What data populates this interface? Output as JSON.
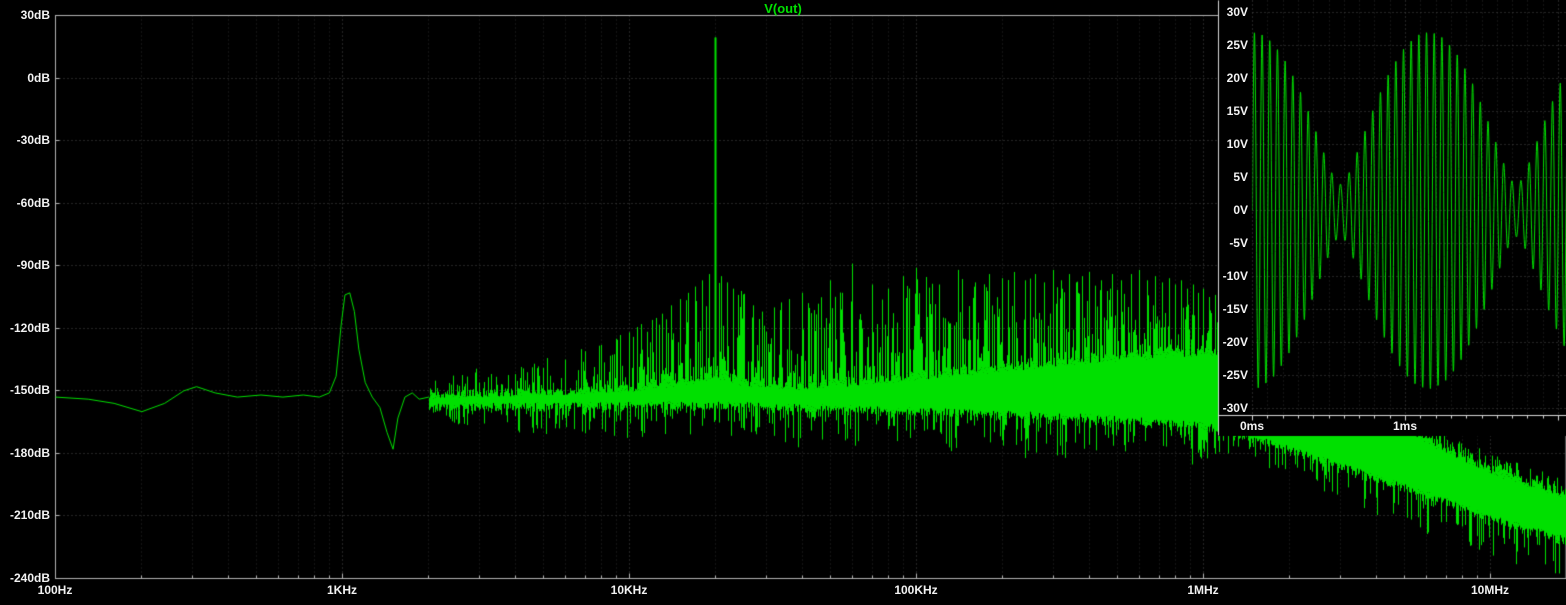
{
  "title": "V(out)",
  "colors": {
    "background": "#000000",
    "trace": "#00e000",
    "title": "#00e000",
    "grid_minor": "#2b2b2b",
    "grid_major": "#4a4a4a",
    "border": "#b4b4b4",
    "inset_border": "#d8d8d8",
    "text": "#f2f2f2"
  },
  "chart_data": [
    {
      "id": "fft-spectrum",
      "type": "line",
      "title": "V(out)",
      "x_axis": {
        "scale": "log",
        "unit": "Hz",
        "range_hz": [
          100,
          18500000
        ],
        "ticks": [
          {
            "label": "100Hz",
            "hz": 100
          },
          {
            "label": "1KHz",
            "hz": 1000
          },
          {
            "label": "10KHz",
            "hz": 10000
          },
          {
            "label": "100KHz",
            "hz": 100000
          },
          {
            "label": "1MHz",
            "hz": 1000000
          },
          {
            "label": "10MHz",
            "hz": 10000000
          }
        ]
      },
      "y_axis": {
        "unit": "dB",
        "range_db": [
          -240,
          30
        ],
        "step_db": 30,
        "ticks": [
          {
            "label": "30dB",
            "db": 30
          },
          {
            "label": "0dB",
            "db": 0
          },
          {
            "label": "-30dB",
            "db": -30
          },
          {
            "label": "-60dB",
            "db": -60
          },
          {
            "label": "-90dB",
            "db": -90
          },
          {
            "label": "-120dB",
            "db": -120
          },
          {
            "label": "-150dB",
            "db": -150
          },
          {
            "label": "-180dB",
            "db": -180
          },
          {
            "label": "-210dB",
            "db": -210
          },
          {
            "label": "-240dB",
            "db": -240
          }
        ]
      },
      "baseline_points_hz_db": [
        [
          100,
          -153
        ],
        [
          130,
          -154
        ],
        [
          160,
          -156
        ],
        [
          200,
          -160
        ],
        [
          240,
          -156
        ],
        [
          280,
          -150
        ],
        [
          310,
          -148
        ],
        [
          360,
          -151
        ],
        [
          430,
          -153
        ],
        [
          520,
          -152
        ],
        [
          620,
          -153
        ],
        [
          730,
          -152
        ],
        [
          830,
          -153
        ],
        [
          900,
          -151
        ],
        [
          950,
          -143
        ],
        [
          990,
          -118
        ],
        [
          1020,
          -104
        ],
        [
          1060,
          -103
        ],
        [
          1100,
          -112
        ],
        [
          1140,
          -130
        ],
        [
          1200,
          -146
        ],
        [
          1270,
          -153
        ],
        [
          1350,
          -158
        ],
        [
          1430,
          -170
        ],
        [
          1500,
          -178
        ],
        [
          1560,
          -163
        ],
        [
          1650,
          -153
        ],
        [
          1750,
          -151
        ],
        [
          1850,
          -154
        ],
        [
          2000,
          -153
        ]
      ],
      "peaks_hz_db": [
        [
          3000,
          -146
        ],
        [
          4000,
          -142
        ],
        [
          5000,
          -139
        ],
        [
          6000,
          -135
        ],
        [
          7000,
          -131
        ],
        [
          8000,
          -128
        ],
        [
          9000,
          -125
        ],
        [
          10000,
          -122
        ],
        [
          11000,
          -118
        ],
        [
          12000,
          -116
        ],
        [
          13000,
          -113
        ],
        [
          14000,
          -109
        ],
        [
          15000,
          -106
        ],
        [
          16000,
          -103
        ],
        [
          17000,
          -100
        ],
        [
          18000,
          -97
        ],
        [
          19000,
          -94
        ],
        [
          20000,
          19.5
        ],
        [
          21000,
          -95
        ],
        [
          22000,
          -98
        ],
        [
          23000,
          -101
        ],
        [
          24000,
          -104
        ],
        [
          25000,
          -106
        ],
        [
          27000,
          -109
        ],
        [
          29000,
          -112
        ],
        [
          32000,
          -110
        ],
        [
          36000,
          -106
        ],
        [
          40000,
          -103
        ],
        [
          50000,
          -97
        ],
        [
          60000,
          -89
        ],
        [
          70000,
          -99
        ],
        [
          80000,
          -101
        ],
        [
          90000,
          -95
        ],
        [
          100000,
          -91
        ],
        [
          120000,
          -99
        ],
        [
          140000,
          -92
        ],
        [
          160000,
          -98
        ],
        [
          180000,
          -94
        ],
        [
          200000,
          -96
        ],
        [
          220000,
          -93
        ],
        [
          240000,
          -97
        ],
        [
          260000,
          -94
        ],
        [
          280000,
          -98
        ],
        [
          300000,
          -92
        ],
        [
          320000,
          -97
        ],
        [
          340000,
          -94
        ],
        [
          360000,
          -98
        ],
        [
          380000,
          -95
        ],
        [
          400000,
          -93
        ],
        [
          440000,
          -97
        ],
        [
          480000,
          -94
        ],
        [
          520000,
          -97
        ],
        [
          560000,
          -94
        ],
        [
          600000,
          -92
        ],
        [
          640000,
          -97
        ],
        [
          680000,
          -95
        ],
        [
          720000,
          -98
        ],
        [
          760000,
          -96
        ],
        [
          800000,
          -99
        ],
        [
          840000,
          -97
        ],
        [
          880000,
          -101
        ],
        [
          920000,
          -99
        ],
        [
          960000,
          -103
        ],
        [
          1000000,
          -101
        ],
        [
          1050000,
          -105
        ],
        [
          1100000,
          -104
        ],
        [
          1150000,
          -108
        ],
        [
          1200000,
          -111
        ]
      ],
      "noise_envelopes": {
        "mass_top_hz_db": [
          [
            2000,
            -152
          ],
          [
            10000,
            -149
          ],
          [
            16000,
            -145
          ],
          [
            20000,
            -142
          ],
          [
            25000,
            -146
          ],
          [
            40000,
            -148
          ],
          [
            100000,
            -143
          ],
          [
            200000,
            -139
          ],
          [
            400000,
            -135
          ],
          [
            800000,
            -132
          ],
          [
            1200000,
            -131
          ],
          [
            1600000,
            -141
          ],
          [
            2500000,
            -153
          ],
          [
            4000000,
            -163
          ],
          [
            6300000,
            -175
          ],
          [
            10000000,
            -188
          ],
          [
            18500000,
            -200
          ]
        ],
        "mass_bottom_hz_db": [
          [
            2000,
            -158
          ],
          [
            20000,
            -157
          ],
          [
            100000,
            -160
          ],
          [
            400000,
            -163
          ],
          [
            1000000,
            -167
          ],
          [
            1600000,
            -174
          ],
          [
            2500000,
            -183
          ],
          [
            4000000,
            -192
          ],
          [
            6300000,
            -201
          ],
          [
            10000000,
            -211
          ],
          [
            18500000,
            -222
          ]
        ],
        "spike_top_hz_db": [
          [
            2000,
            -141
          ],
          [
            4000,
            -137
          ],
          [
            7000,
            -129
          ],
          [
            10000,
            -121
          ],
          [
            13000,
            -112
          ],
          [
            16000,
            -103
          ],
          [
            19000,
            -95
          ],
          [
            20000,
            -93
          ],
          [
            22000,
            -96
          ],
          [
            26000,
            -103
          ],
          [
            32000,
            -108
          ],
          [
            50000,
            -102
          ],
          [
            70000,
            -96
          ],
          [
            100000,
            -95
          ],
          [
            300000,
            -95
          ],
          [
            600000,
            -96
          ],
          [
            900000,
            -101
          ],
          [
            1200000,
            -107
          ],
          [
            1600000,
            -122
          ],
          [
            2500000,
            -138
          ],
          [
            4000000,
            -152
          ],
          [
            6300000,
            -166
          ],
          [
            10000000,
            -180
          ],
          [
            18500000,
            -192
          ]
        ],
        "spike_bottom_hz_db": [
          [
            2000,
            -168
          ],
          [
            10000,
            -174
          ],
          [
            20000,
            -178
          ],
          [
            100000,
            -181
          ],
          [
            400000,
            -183
          ],
          [
            1000000,
            -186
          ],
          [
            1600000,
            -192
          ],
          [
            2500000,
            -200
          ],
          [
            4000000,
            -210
          ],
          [
            6300000,
            -220
          ],
          [
            10000000,
            -230
          ],
          [
            18500000,
            -240
          ]
        ]
      }
    },
    {
      "id": "transient-inset",
      "type": "line",
      "x_axis": {
        "unit": "ms",
        "range_ms": [
          0,
          2.05
        ],
        "ticks": [
          {
            "label": "0ms",
            "ms": 0
          },
          {
            "label": "1ms",
            "ms": 1
          }
        ]
      },
      "y_axis": {
        "unit": "V",
        "range_v": [
          -30,
          30
        ],
        "step_v": 5,
        "ticks": [
          {
            "label": "30V",
            "v": 30
          },
          {
            "label": "25V",
            "v": 25
          },
          {
            "label": "20V",
            "v": 20
          },
          {
            "label": "15V",
            "v": 15
          },
          {
            "label": "10V",
            "v": 10
          },
          {
            "label": "5V",
            "v": 5
          },
          {
            "label": "0V",
            "v": 0
          },
          {
            "label": "-5V",
            "v": -5
          },
          {
            "label": "-10V",
            "v": -10
          },
          {
            "label": "-15V",
            "v": -15
          },
          {
            "label": "-20V",
            "v": -20
          },
          {
            "label": "-25V",
            "v": -25
          },
          {
            "label": "-30V",
            "v": -30
          }
        ]
      },
      "signal": {
        "description": "two-tone beat waveform, envelope max 27V min 4V, beat period 1.15ms",
        "tones": [
          {
            "freq_hz": 19565,
            "amp_v": 15.5
          },
          {
            "freq_hz": 20435,
            "amp_v": 11.5
          }
        ]
      }
    }
  ]
}
